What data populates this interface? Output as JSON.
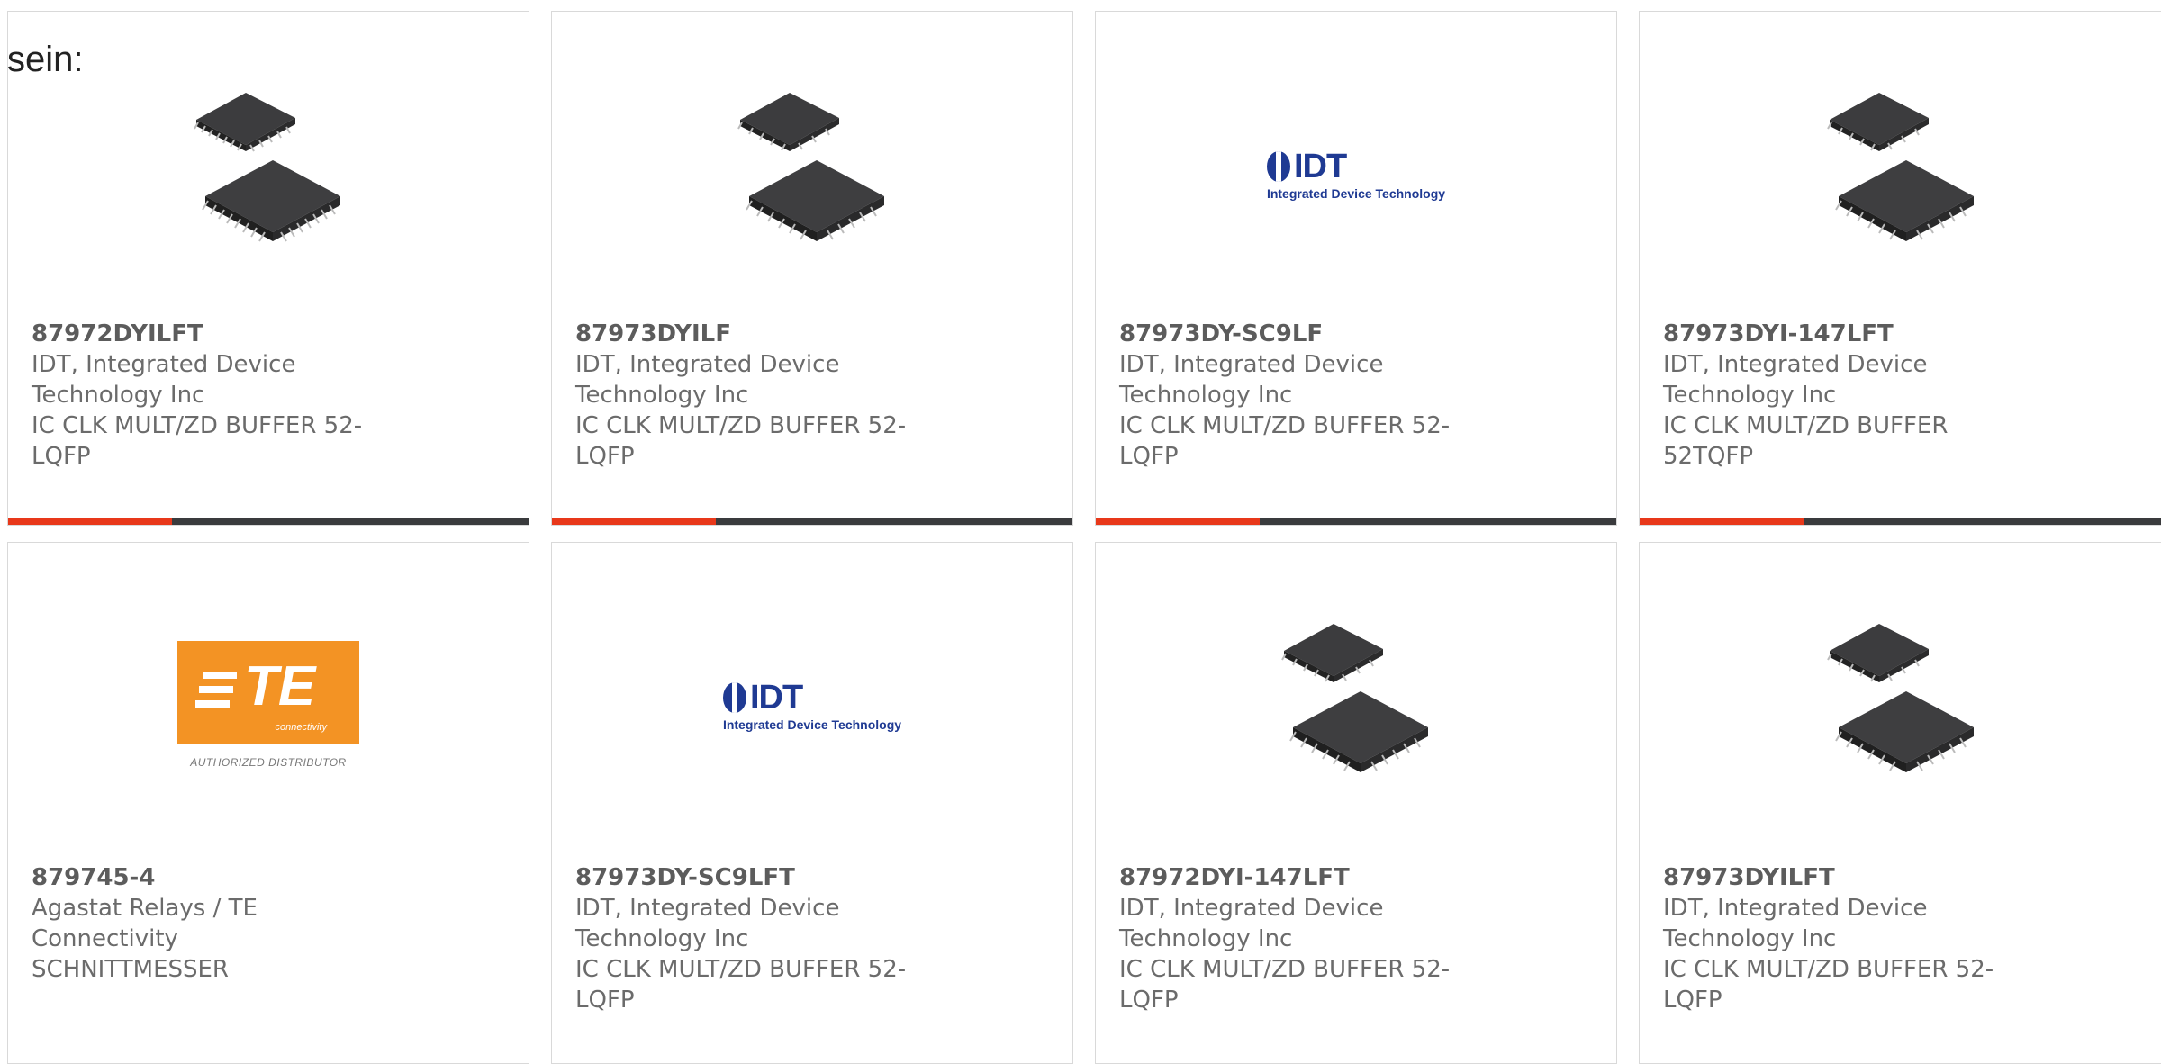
{
  "intro_text": "sein:",
  "brand_colors": {
    "accent": "#e8381a",
    "bar": "#3a3b3d",
    "te_orange": "#f39324",
    "idt_blue": "#1f3a93"
  },
  "products": [
    {
      "part": "87972DYILFT",
      "maker": [
        "IDT, Integrated Device",
        "Technology Inc"
      ],
      "desc": [
        "IC CLK MULT/ZD BUFFER 52-",
        "LQFP"
      ],
      "image": "ic-chip-icon"
    },
    {
      "part": "87973DYILF",
      "maker": [
        "IDT, Integrated Device",
        "Technology Inc"
      ],
      "desc": [
        "IC CLK MULT/ZD BUFFER 52-",
        "LQFP"
      ],
      "image": "ic-chip-icon"
    },
    {
      "part": "87973DY-SC9LF",
      "maker": [
        "IDT, Integrated Device",
        "Technology Inc"
      ],
      "desc": [
        "IC CLK MULT/ZD BUFFER 52-",
        "LQFP"
      ],
      "image": "idt-logo",
      "logo_text": "IDT",
      "logo_sub": "Integrated Device Technology"
    },
    {
      "part": "87973DYI-147LFT",
      "maker": [
        "IDT, Integrated Device",
        "Technology Inc"
      ],
      "desc": [
        "IC CLK MULT/ZD BUFFER 52TQFP"
      ],
      "image": "ic-chip-icon"
    },
    {
      "part": "879745-4",
      "maker": [
        "Agastat Relays / TE Connectivity"
      ],
      "desc": [
        "SCHNITTMESSER"
      ],
      "image": "te-logo",
      "logo_text": "TE",
      "logo_sub": "connectivity",
      "logo_caption": "AUTHORIZED DISTRIBUTOR"
    },
    {
      "part": "87973DY-SC9LFT",
      "maker": [
        "IDT, Integrated Device",
        "Technology Inc"
      ],
      "desc": [
        "IC CLK MULT/ZD BUFFER 52-",
        "LQFP"
      ],
      "image": "idt-logo",
      "logo_text": "IDT",
      "logo_sub": "Integrated Device Technology"
    },
    {
      "part": "87972DYI-147LFT",
      "maker": [
        "IDT, Integrated Device",
        "Technology Inc"
      ],
      "desc": [
        "IC CLK MULT/ZD BUFFER 52-",
        "LQFP"
      ],
      "image": "ic-chip-icon"
    },
    {
      "part": "87973DYILFT",
      "maker": [
        "IDT, Integrated Device",
        "Technology Inc"
      ],
      "desc": [
        "IC CLK MULT/ZD BUFFER 52-",
        "LQFP"
      ],
      "image": "ic-chip-icon"
    }
  ]
}
